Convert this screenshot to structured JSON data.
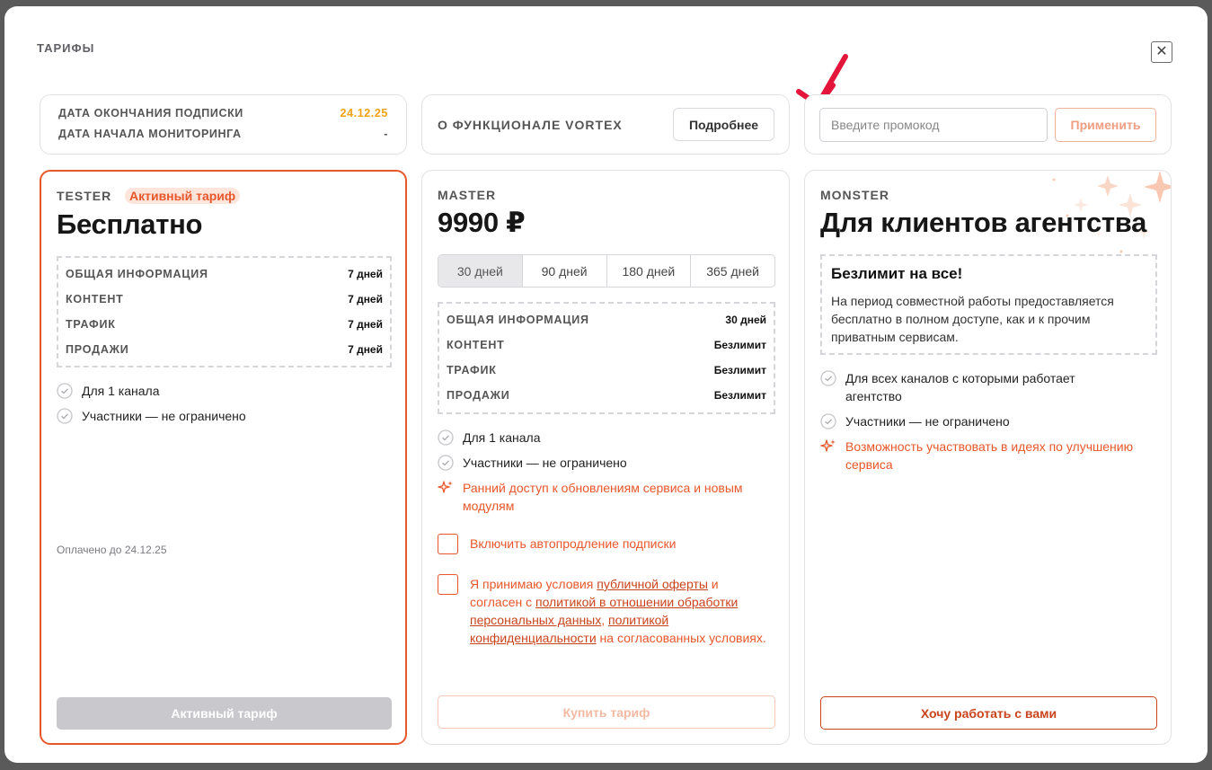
{
  "modal": {
    "title": "ТАРИФЫ"
  },
  "subscription": {
    "end_label": "ДАТА ОКОНЧАНИЯ ПОДПИСКИ",
    "end_value": "24.12.25",
    "start_label": "ДАТА НАЧАЛА МОНИТОРИНГА",
    "start_value": "-"
  },
  "about": {
    "label": "О ФУНКЦИОНАЛЕ VORTEX",
    "button": "Подробнее"
  },
  "promo": {
    "placeholder": "Введите промокод",
    "apply": "Применить"
  },
  "tester": {
    "name": "TESTER",
    "badge": "Активный тариф",
    "price": "Бесплатно",
    "rows": [
      {
        "k": "ОБЩАЯ ИНФОРМАЦИЯ",
        "v": "7 дней"
      },
      {
        "k": "КОНТЕНТ",
        "v": "7 дней"
      },
      {
        "k": "ТРАФИК",
        "v": "7 дней"
      },
      {
        "k": "ПРОДАЖИ",
        "v": "7 дней"
      }
    ],
    "features": [
      "Для 1 канала",
      "Участники — не ограничено"
    ],
    "paid_until": "Оплачено до 24.12.25",
    "button": "Активный тариф"
  },
  "master": {
    "name": "MASTER",
    "price": "9990 ₽",
    "periods": [
      "30 дней",
      "90 дней",
      "180 дней",
      "365 дней"
    ],
    "rows": [
      {
        "k": "ОБЩАЯ ИНФОРМАЦИЯ",
        "v": "30 дней"
      },
      {
        "k": "КОНТЕНТ",
        "v": "Безлимит"
      },
      {
        "k": "ТРАФИК",
        "v": "Безлимит"
      },
      {
        "k": "ПРОДАЖИ",
        "v": "Безлимит"
      }
    ],
    "features": [
      "Для 1 канала",
      "Участники — не ограничено"
    ],
    "highlight": "Ранний доступ к обновлениям сервиса и новым модулям",
    "autorenew": "Включить автопродление подписки",
    "terms": {
      "t1": "Я принимаю условия ",
      "l1": "публичной оферты",
      "t2": " и согласен с ",
      "l2": "политикой в отношении обработки персональных данных",
      "t3": ", ",
      "l3": "политикой конфиденциальности",
      "t4": " на согласованных условиях."
    },
    "button": "Купить тариф"
  },
  "monster": {
    "name": "MONSTER",
    "price": "Для клиентов агентства",
    "unlimited_title": "Безлимит на все!",
    "unlimited_text": "На период совместной работы предоставляется бесплатно в полном доступе, как и к прочим приватным сервисам.",
    "features": [
      "Для всех каналов с которыми работает агентство",
      "Участники — не ограничено"
    ],
    "highlight": "Возможность участвовать в идеях по улучшению сервиса",
    "button": "Хочу работать с вами"
  },
  "colors": {
    "accent": "#e8572a",
    "date": "#f2a115",
    "border": "#e2e2e6"
  }
}
